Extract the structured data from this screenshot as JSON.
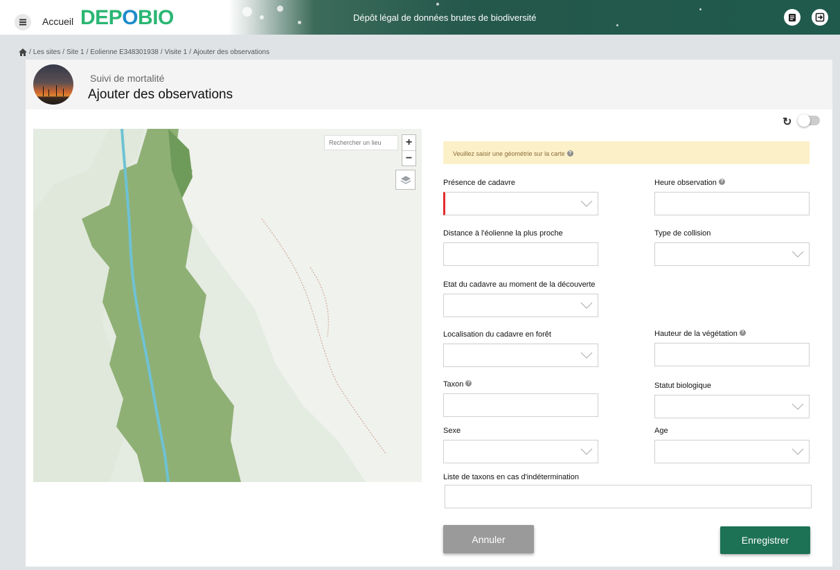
{
  "header": {
    "home_label": "Accueil",
    "logo": {
      "part1": "DEP",
      "part2": "O",
      "part3": "BIO"
    },
    "site_title": "Dépôt légal de données brutes de biodiversité"
  },
  "breadcrumb": [
    "Les sites",
    "Site 1",
    "Eolienne E348301938",
    "Visite 1",
    "Ajouter des observations"
  ],
  "title_panel": {
    "subtitle": "Suivi de mortalité",
    "title": "Ajouter des observations"
  },
  "map": {
    "search_placeholder": "Rechercher un lieu",
    "zoom_in": "+",
    "zoom_out": "−"
  },
  "form": {
    "alert": "Veuillez saisir une géométrie sur la carte",
    "help_glyph": "?",
    "fields": {
      "presence": "Présence de cadavre",
      "heure": "Heure observation",
      "distance": "Distance à l'éolienne la plus proche",
      "collision": "Type de collision",
      "etat": "Etat du cadavre au moment de la découverte",
      "localisation": "Localisation du cadavre en forêt",
      "hauteur": "Hauteur de la végétation",
      "taxon": "Taxon",
      "statut": "Statut biologique",
      "sexe": "Sexe",
      "age": "Age",
      "liste_taxons": "Liste de taxons en cas d'indétermination"
    },
    "cancel_label": "Annuler",
    "save_label": "Enregistrer"
  },
  "colors": {
    "brand_green": "#2bb673",
    "brand_blue": "#1e8ccb",
    "header_dark": "#1f5a4c",
    "save_button": "#1d7155",
    "cancel_button": "#9a9a9a",
    "required_marker": "#e32b2b",
    "alert_bg": "#fcf0c8"
  },
  "icons": {
    "menu": "menu-icon",
    "home": "home-icon",
    "docs": "document-icon",
    "logout": "logout-icon",
    "refresh": "refresh-icon",
    "layers": "layers-icon",
    "chevron": "chevron-down-icon"
  }
}
